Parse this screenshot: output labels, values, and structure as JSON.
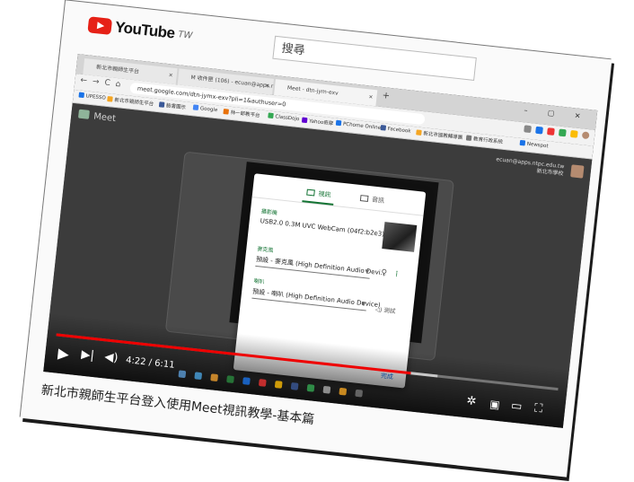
{
  "header": {
    "logo_text": "YouTube",
    "region": "TW",
    "search_placeholder": "搜尋"
  },
  "browser": {
    "tabs": [
      {
        "label": "新北市親師生平台"
      },
      {
        "label": "M 收件匣 (106) - ecuan@apps.nt..."
      },
      {
        "label": "Meet - dtn-jym-exv",
        "active": true
      }
    ],
    "new_tab": "+",
    "window_controls": "– ▢ ✕",
    "url": "meet.google.com/dtn-jymx-exv?pli=1&authuser=0",
    "bookmarks": [
      "UPESSO",
      "新北市親師生平台",
      "臉書圖示",
      "Google",
      "林一郎教平台",
      "ClassDojo",
      "Yahoo奇摩",
      "PChome Online",
      "Facebook",
      "新北市國教輔導團",
      "教育行政系統",
      "Newspot"
    ]
  },
  "meet": {
    "app_name": "Meet",
    "user_email": "ecuan@apps.ntpc.edu.tw",
    "user_org": "新北市學校"
  },
  "dialog": {
    "tab_video": "視訊",
    "tab_audio": "音訊",
    "camera_label": "攝影機",
    "camera_value": "USB2.0 0.3M UVC WebCam (04f2:b2e3)",
    "mic_label": "麥克風",
    "mic_value": "預設 - 麥克風 (High Definition Audio Devi...",
    "speaker_label": "喇叭",
    "speaker_value": "預設 - 喇叭 (High Definition Audio Device)",
    "test_label": "測試",
    "done_label": "完成"
  },
  "player": {
    "time": "4:22 / 6:11",
    "progress_fraction": 0.707,
    "buffered_fraction": 0.76
  },
  "video_title": "新北市親師生平台登入使用Meet視訊教學-基本篇",
  "colors": {
    "youtube_red": "#e62117",
    "progress_red": "#ee0000",
    "meet_green": "#137333"
  }
}
